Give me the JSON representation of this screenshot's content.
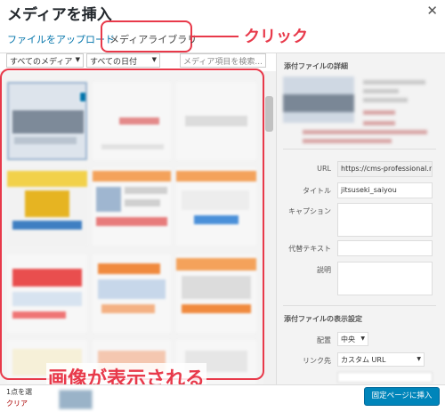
{
  "modal": {
    "title": "メディアを挿入",
    "close_icon": "close-icon"
  },
  "router": {
    "upload_tab": "ファイルをアップロード",
    "library_tab": "メディアライブラリ"
  },
  "annotations": {
    "click_label": "クリック",
    "grid_label": "画像が表示される",
    "color": "#e8394a"
  },
  "toolbar": {
    "type_filter": "すべてのメディア",
    "date_filter": "すべての日付",
    "search_placeholder": "メディア項目を検索..."
  },
  "attachment_details": {
    "heading": "添付ファイルの詳細",
    "url_label": "URL",
    "url_value": "https://cms-professional.ne",
    "title_label": "タイトル",
    "title_value": "jitsuseki_saiyou",
    "caption_label": "キャプション",
    "alt_label": "代替テキスト",
    "description_label": "説明"
  },
  "display_settings": {
    "heading": "添付ファイルの表示設定",
    "align_label": "配置",
    "align_value": "中央",
    "link_label": "リンク先",
    "link_value": "カスタム URL"
  },
  "footer": {
    "selection_count": "1点を選",
    "clear_link": "クリア",
    "insert_button": "固定ページに挿入"
  },
  "colors": {
    "accent": "#0073aa",
    "primary_button": "#0085ba",
    "highlight": "#e8394a"
  }
}
